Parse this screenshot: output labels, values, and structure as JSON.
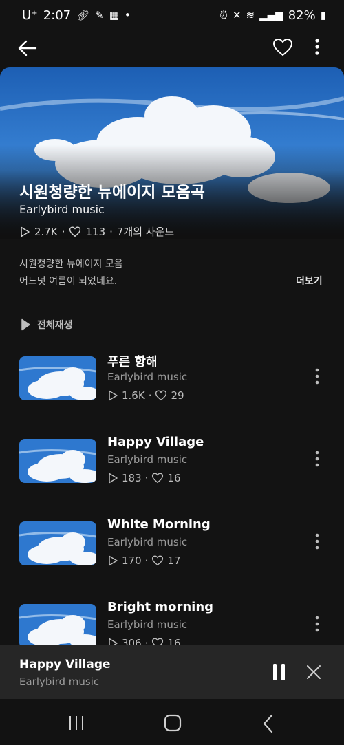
{
  "status_bar": {
    "carrier": "U⁺",
    "time": "2:07",
    "battery": "82%"
  },
  "album": {
    "title": "시원청량한 뉴에이지 모음곡",
    "artist": "Earlybird music",
    "plays": "2.7K",
    "likes": "113",
    "sounds": "7개의 사운드",
    "description_line1": "시원청량한 뉴에이지 모음",
    "description_line2": "어느덧 여름이 되었네요.",
    "more_label": "더보기",
    "play_all_label": "전체재생"
  },
  "tracks": [
    {
      "title": "푸른 항해",
      "artist": "Earlybird music",
      "plays": "1.6K",
      "likes": "29"
    },
    {
      "title": "Happy Village",
      "artist": "Earlybird music",
      "plays": "183",
      "likes": "16"
    },
    {
      "title": "White Morning",
      "artist": "Earlybird music",
      "plays": "170",
      "likes": "17"
    },
    {
      "title": "Bright morning",
      "artist": "Earlybird music",
      "plays": "306",
      "likes": "16"
    }
  ],
  "mini_player": {
    "title": "Happy Village",
    "artist": "Earlybird music"
  },
  "colors": {
    "background": "#131313",
    "sky": "#2a6fc4"
  }
}
